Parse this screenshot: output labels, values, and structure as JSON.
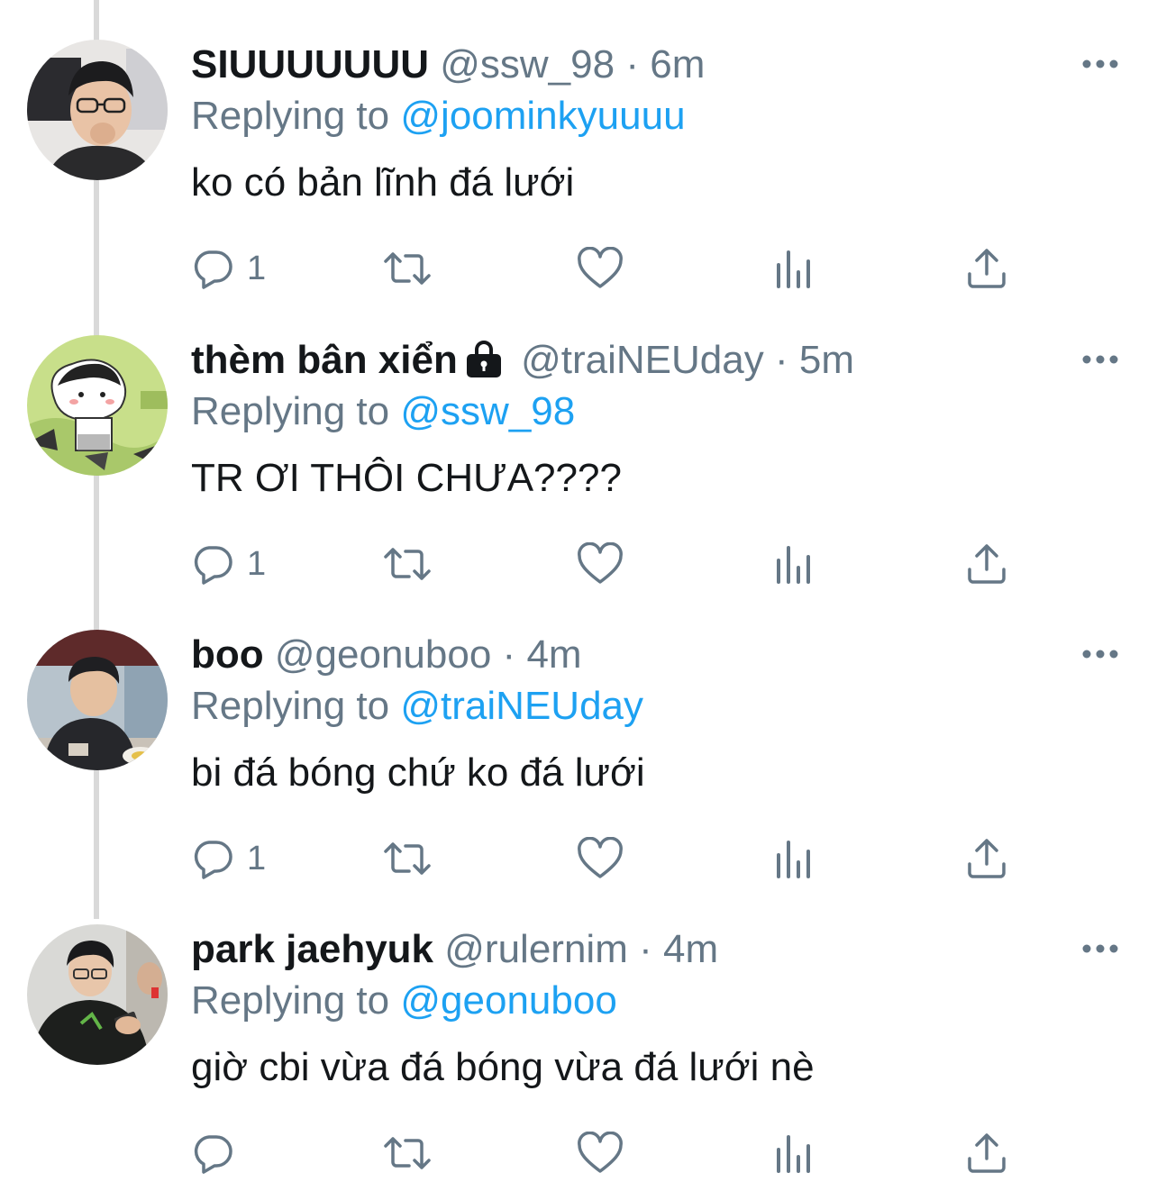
{
  "colors": {
    "name": "#14171a",
    "secondary": "#657786",
    "mention": "#1da1f2",
    "thread_line": "#d9d9d9"
  },
  "separator": "·",
  "replying_prefix": "Replying to",
  "icons": {
    "reply": "reply-icon",
    "retweet": "retweet-icon",
    "like": "heart-icon",
    "analytics": "analytics-icon",
    "share": "share-icon",
    "more": "more-icon",
    "lock": "lock-icon"
  },
  "tweets": [
    {
      "name": "SIUUUUUUU",
      "handle": "@ssw_98",
      "time": "6m",
      "locked": false,
      "reply_to": "@joominkyuuuu",
      "text": "ko có bản lĩnh đá lưới",
      "reply_count": "1",
      "avatar": "avatar-photo-glasses-hand-to-mouth"
    },
    {
      "name": "thèm bân xiển",
      "handle": "@traiNEUday",
      "time": "5m",
      "locked": true,
      "reply_to": "@ssw_98",
      "text": "TR ƠI THÔI CHƯA????",
      "reply_count": "1",
      "avatar": "avatar-cartoon"
    },
    {
      "name": "boo",
      "handle": "@geonuboo",
      "time": "4m",
      "locked": false,
      "reply_to": "@traiNEUday",
      "text": "bi đá bóng chứ ko đá lưới",
      "reply_count": "1",
      "avatar": "avatar-photo-eating"
    },
    {
      "name": "park jaehyuk",
      "handle": "@rulernim",
      "time": "4m",
      "locked": false,
      "reply_to": "@geonuboo",
      "text": "giờ cbi vừa đá bóng vừa đá lưới nè",
      "reply_count": "",
      "avatar": "avatar-photo-phone"
    }
  ]
}
